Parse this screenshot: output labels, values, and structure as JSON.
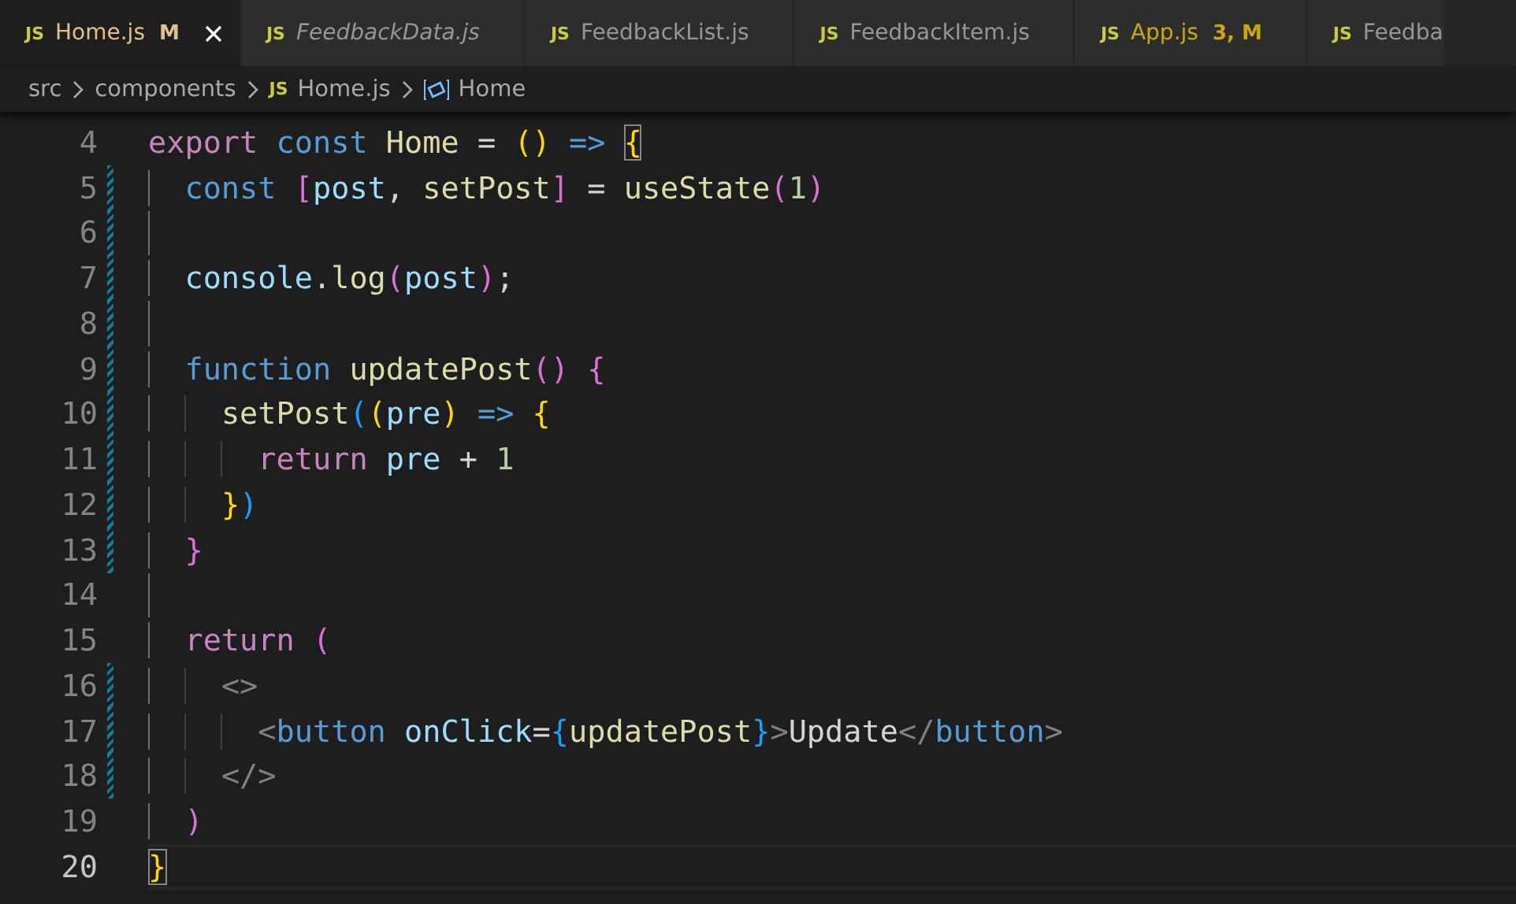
{
  "tabs": [
    {
      "icon_text": "JS",
      "label": "Home.js",
      "badge": "M",
      "color": "#e2c08d",
      "selected": true,
      "preview": false
    },
    {
      "icon_text": "JS",
      "label": "FeedbackData.js",
      "color": "#969696",
      "selected": false,
      "preview": true
    },
    {
      "icon_text": "JS",
      "label": "FeedbackList.js",
      "color": "#969696",
      "selected": false,
      "preview": false
    },
    {
      "icon_text": "JS",
      "label": "FeedbackItem.js",
      "color": "#969696",
      "selected": false,
      "preview": false
    },
    {
      "icon_text": "JS",
      "label": "App.js",
      "badge": "3, M",
      "color": "#cca700",
      "selected": false,
      "preview": false
    },
    {
      "icon_text": "JS",
      "label": "Feedba",
      "color": "#969696",
      "selected": false,
      "preview": false
    }
  ],
  "breadcrumbs": [
    {
      "kind": "folder",
      "label": "src"
    },
    {
      "kind": "folder",
      "label": "components"
    },
    {
      "kind": "file",
      "icon_text": "JS",
      "label": "Home.js"
    },
    {
      "kind": "symbol",
      "label": "Home"
    }
  ],
  "editor": {
    "lines": [
      {
        "number": "4",
        "modified": false,
        "current": false,
        "tokens": [
          {
            "kind": "keyword",
            "text": "export "
          },
          {
            "kind": "storage",
            "text": "const "
          },
          {
            "kind": "function",
            "text": "Home"
          },
          {
            "kind": "plain",
            "text": " = "
          },
          {
            "kind": "bracket1",
            "text": "() "
          },
          {
            "kind": "storage",
            "text": "=> "
          },
          {
            "kind": "bracket-match",
            "text": "{"
          }
        ]
      },
      {
        "number": "5",
        "modified": true,
        "current": false,
        "tokens": [
          {
            "kind": "storage",
            "text": "  const "
          },
          {
            "kind": "bracket2",
            "text": "["
          },
          {
            "kind": "variable",
            "text": "post"
          },
          {
            "kind": "plain",
            "text": ", "
          },
          {
            "kind": "function",
            "text": "setPost"
          },
          {
            "kind": "bracket2",
            "text": "]"
          },
          {
            "kind": "plain",
            "text": " = "
          },
          {
            "kind": "function",
            "text": "useState"
          },
          {
            "kind": "bracket2",
            "text": "("
          },
          {
            "kind": "number",
            "text": "1"
          },
          {
            "kind": "bracket2",
            "text": ")"
          }
        ]
      },
      {
        "number": "6",
        "modified": true,
        "current": false
      },
      {
        "number": "7",
        "modified": true,
        "current": false,
        "tokens": [
          {
            "kind": "variable",
            "text": "  console"
          },
          {
            "kind": "plain",
            "text": "."
          },
          {
            "kind": "function",
            "text": "log"
          },
          {
            "kind": "bracket2",
            "text": "("
          },
          {
            "kind": "variable",
            "text": "post"
          },
          {
            "kind": "bracket2",
            "text": ")"
          },
          {
            "kind": "plain",
            "text": ";"
          }
        ]
      },
      {
        "number": "8",
        "modified": true,
        "current": false
      },
      {
        "number": "9",
        "modified": true,
        "current": false,
        "tokens": [
          {
            "kind": "storage",
            "text": "  function "
          },
          {
            "kind": "function",
            "text": "updatePost"
          },
          {
            "kind": "bracket2",
            "text": "() {"
          }
        ]
      },
      {
        "number": "10",
        "modified": true,
        "current": false,
        "tokens": [
          {
            "kind": "function",
            "text": "    setPost"
          },
          {
            "kind": "bracket3",
            "text": "("
          },
          {
            "kind": "bracket1",
            "text": "("
          },
          {
            "kind": "variable",
            "text": "pre"
          },
          {
            "kind": "bracket1",
            "text": ") "
          },
          {
            "kind": "storage",
            "text": "=> "
          },
          {
            "kind": "bracket1",
            "text": "{"
          }
        ]
      },
      {
        "number": "11",
        "modified": true,
        "current": false,
        "tokens": [
          {
            "kind": "keyword",
            "text": "      return "
          },
          {
            "kind": "variable",
            "text": "pre"
          },
          {
            "kind": "plain",
            "text": " + "
          },
          {
            "kind": "number",
            "text": "1"
          }
        ]
      },
      {
        "number": "12",
        "modified": true,
        "current": false,
        "tokens": [
          {
            "kind": "bracket1",
            "text": "    }"
          },
          {
            "kind": "bracket3",
            "text": ")"
          }
        ]
      },
      {
        "number": "13",
        "modified": true,
        "current": false,
        "tokens": [
          {
            "kind": "bracket2",
            "text": "  }"
          }
        ]
      },
      {
        "number": "14",
        "modified": false,
        "current": false
      },
      {
        "number": "15",
        "modified": false,
        "current": false,
        "tokens": [
          {
            "kind": "keyword",
            "text": "  return "
          },
          {
            "kind": "bracket2",
            "text": "("
          }
        ]
      },
      {
        "number": "16",
        "modified": true,
        "current": false,
        "tokens": [
          {
            "kind": "tag-punct",
            "text": "    <>"
          }
        ]
      },
      {
        "number": "17",
        "modified": true,
        "current": false,
        "tokens": [
          {
            "kind": "tag-punct",
            "text": "      <"
          },
          {
            "kind": "storage",
            "text": "button "
          },
          {
            "kind": "variable",
            "text": "onClick"
          },
          {
            "kind": "plain",
            "text": "="
          },
          {
            "kind": "bracket3",
            "text": "{"
          },
          {
            "kind": "function",
            "text": "updatePost"
          },
          {
            "kind": "bracket3",
            "text": "}"
          },
          {
            "kind": "tag-punct",
            "text": ">"
          },
          {
            "kind": "plain",
            "text": "Update"
          },
          {
            "kind": "tag-punct",
            "text": "</"
          },
          {
            "kind": "storage",
            "text": "button"
          },
          {
            "kind": "tag-punct",
            "text": ">"
          }
        ]
      },
      {
        "number": "18",
        "modified": true,
        "current": false,
        "tokens": [
          {
            "kind": "tag-punct",
            "text": "    </>"
          }
        ]
      },
      {
        "number": "19",
        "modified": false,
        "current": false,
        "tokens": [
          {
            "kind": "bracket2",
            "text": "  )"
          }
        ]
      },
      {
        "number": "20",
        "modified": false,
        "current": true,
        "tokens": [
          {
            "kind": "bracket-match",
            "text": "}"
          }
        ]
      }
    ]
  }
}
